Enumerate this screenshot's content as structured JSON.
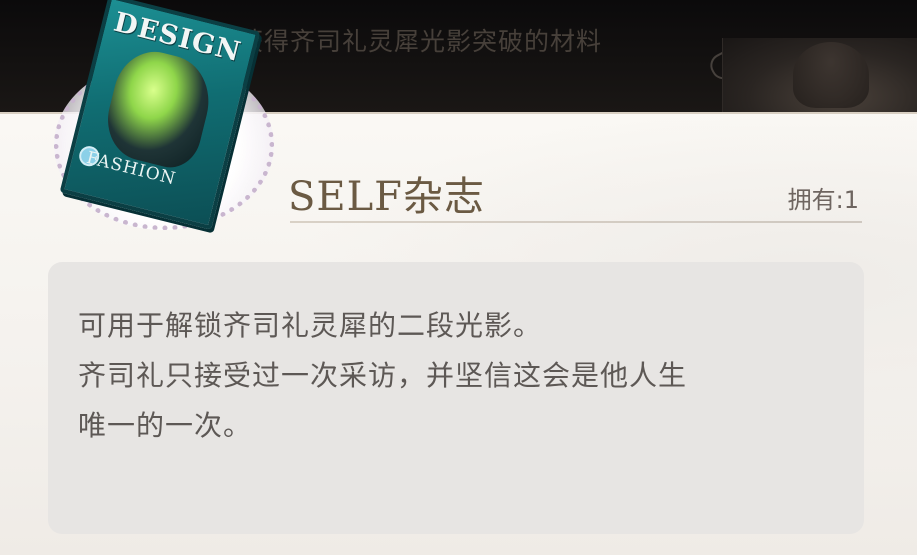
{
  "banner": {
    "text": "获得齐司礼灵犀光影突破的材料"
  },
  "item": {
    "name": "SELF杂志",
    "owned": "拥有:1",
    "icon_name": "self-magazine-icon",
    "icon_lettering": {
      "title": "DESIGN",
      "subtitle": "FASHION"
    },
    "description": [
      "可用于解锁齐司礼灵犀的二段光影。",
      "齐司礼只接受过一次采访，并坚信这会是他人生",
      "唯一的一次。"
    ]
  },
  "colors": {
    "top_bar": "#0b0a0b",
    "card_bg": "#f7f4f0",
    "title_color": "#6b5a43",
    "desc_box_bg": "#e7e5e3",
    "text_color": "#5d5855",
    "magazine_teal": "#16878c"
  }
}
